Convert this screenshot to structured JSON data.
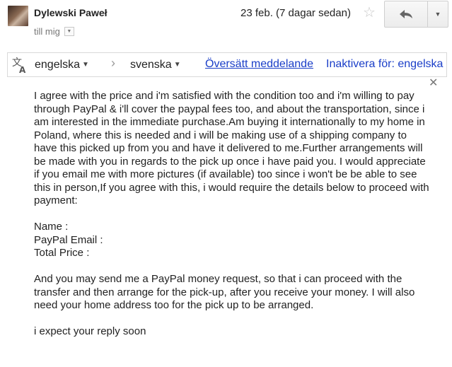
{
  "header": {
    "sender_name": "Dylewski Paweł",
    "recipient_label": "till mig",
    "date": "23 feb. (7 dagar sedan)"
  },
  "icons": {
    "avatar": "avatar-photo",
    "star": "star-icon",
    "reply": "reply-arrow-icon",
    "more": "chevron-down-icon",
    "translate": "translate-icon",
    "close": "close-icon"
  },
  "translate_bar": {
    "source_language": "engelska",
    "target_language": "svenska",
    "translate_link": "Översätt meddelande",
    "disable_link": "Inaktivera för: engelska"
  },
  "message": {
    "paragraph1": "I agree with the price and i'm satisfied with the condition too and i'm willing to pay through PayPal & i'll cover the paypal fees too, and about the transportation, since i am interested in the immediate purchase.Am buying it internationally to my home in Poland, where this is needed and i will be making use of a shipping company to have this picked up from you and have it delivered to me.Further arrangements will be made with you in regards to the pick up once i have paid you. I would appreciate if you email me with more pictures (if available) too since i won't be be able to see this in person,If you agree with this, i would require the details below to proceed with payment:",
    "field_name": "Name :",
    "field_email": "PayPal Email :",
    "field_total": "Total Price :",
    "paragraph2": "And you may send me a PayPal money request, so that i can proceed with the transfer and then  arrange for the pick-up, after you receive your money. I will also need your home address too for the pick up to be arranged.",
    "closing": "i expect your reply soon"
  }
}
